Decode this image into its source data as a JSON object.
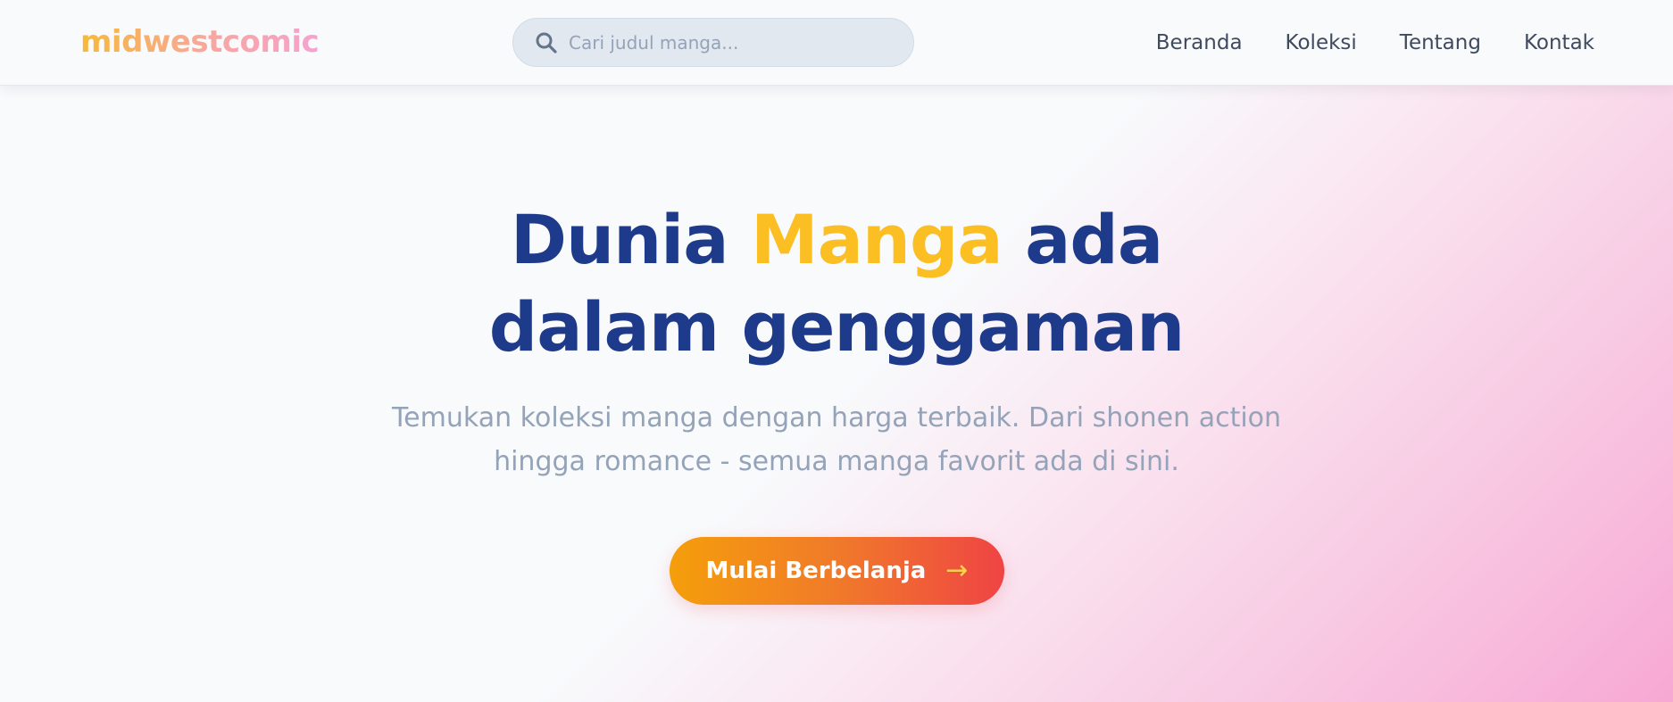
{
  "brand": {
    "logo_text": "midwestcomic"
  },
  "search": {
    "placeholder": "Cari judul manga...",
    "value": "",
    "icon": "search-icon"
  },
  "nav": {
    "items": [
      {
        "label": "Beranda"
      },
      {
        "label": "Koleksi"
      },
      {
        "label": "Tentang"
      },
      {
        "label": "Kontak"
      }
    ]
  },
  "hero": {
    "title_part1": "Dunia ",
    "title_accent": "Manga",
    "title_part2": " ada",
    "title_line2": "dalam genggaman",
    "subtitle_line1": "Temukan koleksi manga dengan harga terbaik. Dari shonen action",
    "subtitle_line2": "hingga romance - semua manga favorit ada di sini.",
    "cta_label": "Mulai Berbelanja",
    "cta_arrow": "→"
  },
  "colors": {
    "primary_navy": "#1e3a8a",
    "accent_yellow": "#fbbf24",
    "cta_start": "#f59e0b",
    "cta_end": "#ef4444",
    "hero_pink": "#f7a8d4",
    "muted_text": "#94a3b8",
    "nav_text": "#3f4a5e"
  }
}
